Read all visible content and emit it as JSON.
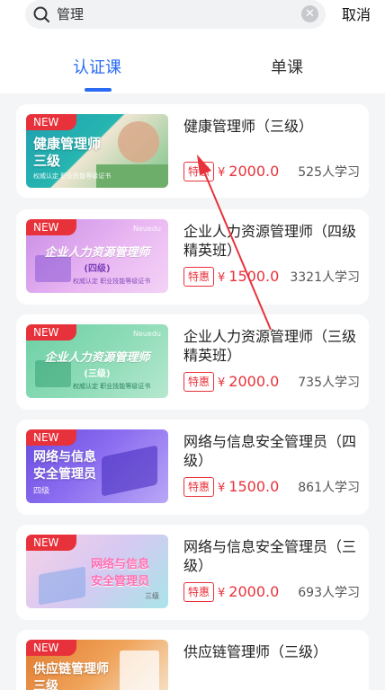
{
  "search": {
    "query": "管理",
    "cancel_label": "取消"
  },
  "tabs": [
    {
      "label": "认证课"
    },
    {
      "label": "单课"
    }
  ],
  "courses": [
    {
      "badge": "NEW",
      "thumb_title": "健康管理师\n三级",
      "thumb_tag": "权威认定 职业技能等级证书",
      "title": "健康管理师（三级）",
      "promo": "特惠",
      "currency": "¥",
      "price": "2000.0",
      "learners": "525人学习"
    },
    {
      "badge": "NEW",
      "thumb_brand": "Neuedu",
      "thumb_title": "企业人力资源管理师",
      "thumb_sub": "(四级)",
      "thumb_tag": "权威认定 职业技能等级证书",
      "title": "企业人力资源管理师（四级精英班）",
      "promo": "特惠",
      "currency": "¥",
      "price": "1500.0",
      "learners": "3321人学习"
    },
    {
      "badge": "NEW",
      "thumb_brand": "Neuedu",
      "thumb_title": "企业人力资源管理师",
      "thumb_sub": "(三级)",
      "thumb_tag": "权威认定 职业技能等级证书",
      "title": "企业人力资源管理师（三级精英班）",
      "promo": "特惠",
      "currency": "¥",
      "price": "2000.0",
      "learners": "735人学习"
    },
    {
      "badge": "NEW",
      "thumb_title": "网络与信息\n安全管理员",
      "thumb_tag": "四级",
      "title": "网络与信息安全管理员（四级）",
      "promo": "特惠",
      "currency": "¥",
      "price": "1500.0",
      "learners": "861人学习"
    },
    {
      "badge": "NEW",
      "thumb_title": "网络与信息\n安全管理员",
      "thumb_tag": "三级",
      "title": "网络与信息安全管理员（三级）",
      "promo": "特惠",
      "currency": "¥",
      "price": "2000.0",
      "learners": "693人学习"
    },
    {
      "badge": "NEW",
      "thumb_title": "供应链管理师\n三级",
      "title": "供应链管理师（三级）"
    }
  ],
  "colors": {
    "accent": "#2a6af5",
    "price_red": "#e8323b"
  },
  "icons": {
    "search": "search-icon",
    "clear": "clear-icon",
    "annotation": "arrow-annotation"
  }
}
